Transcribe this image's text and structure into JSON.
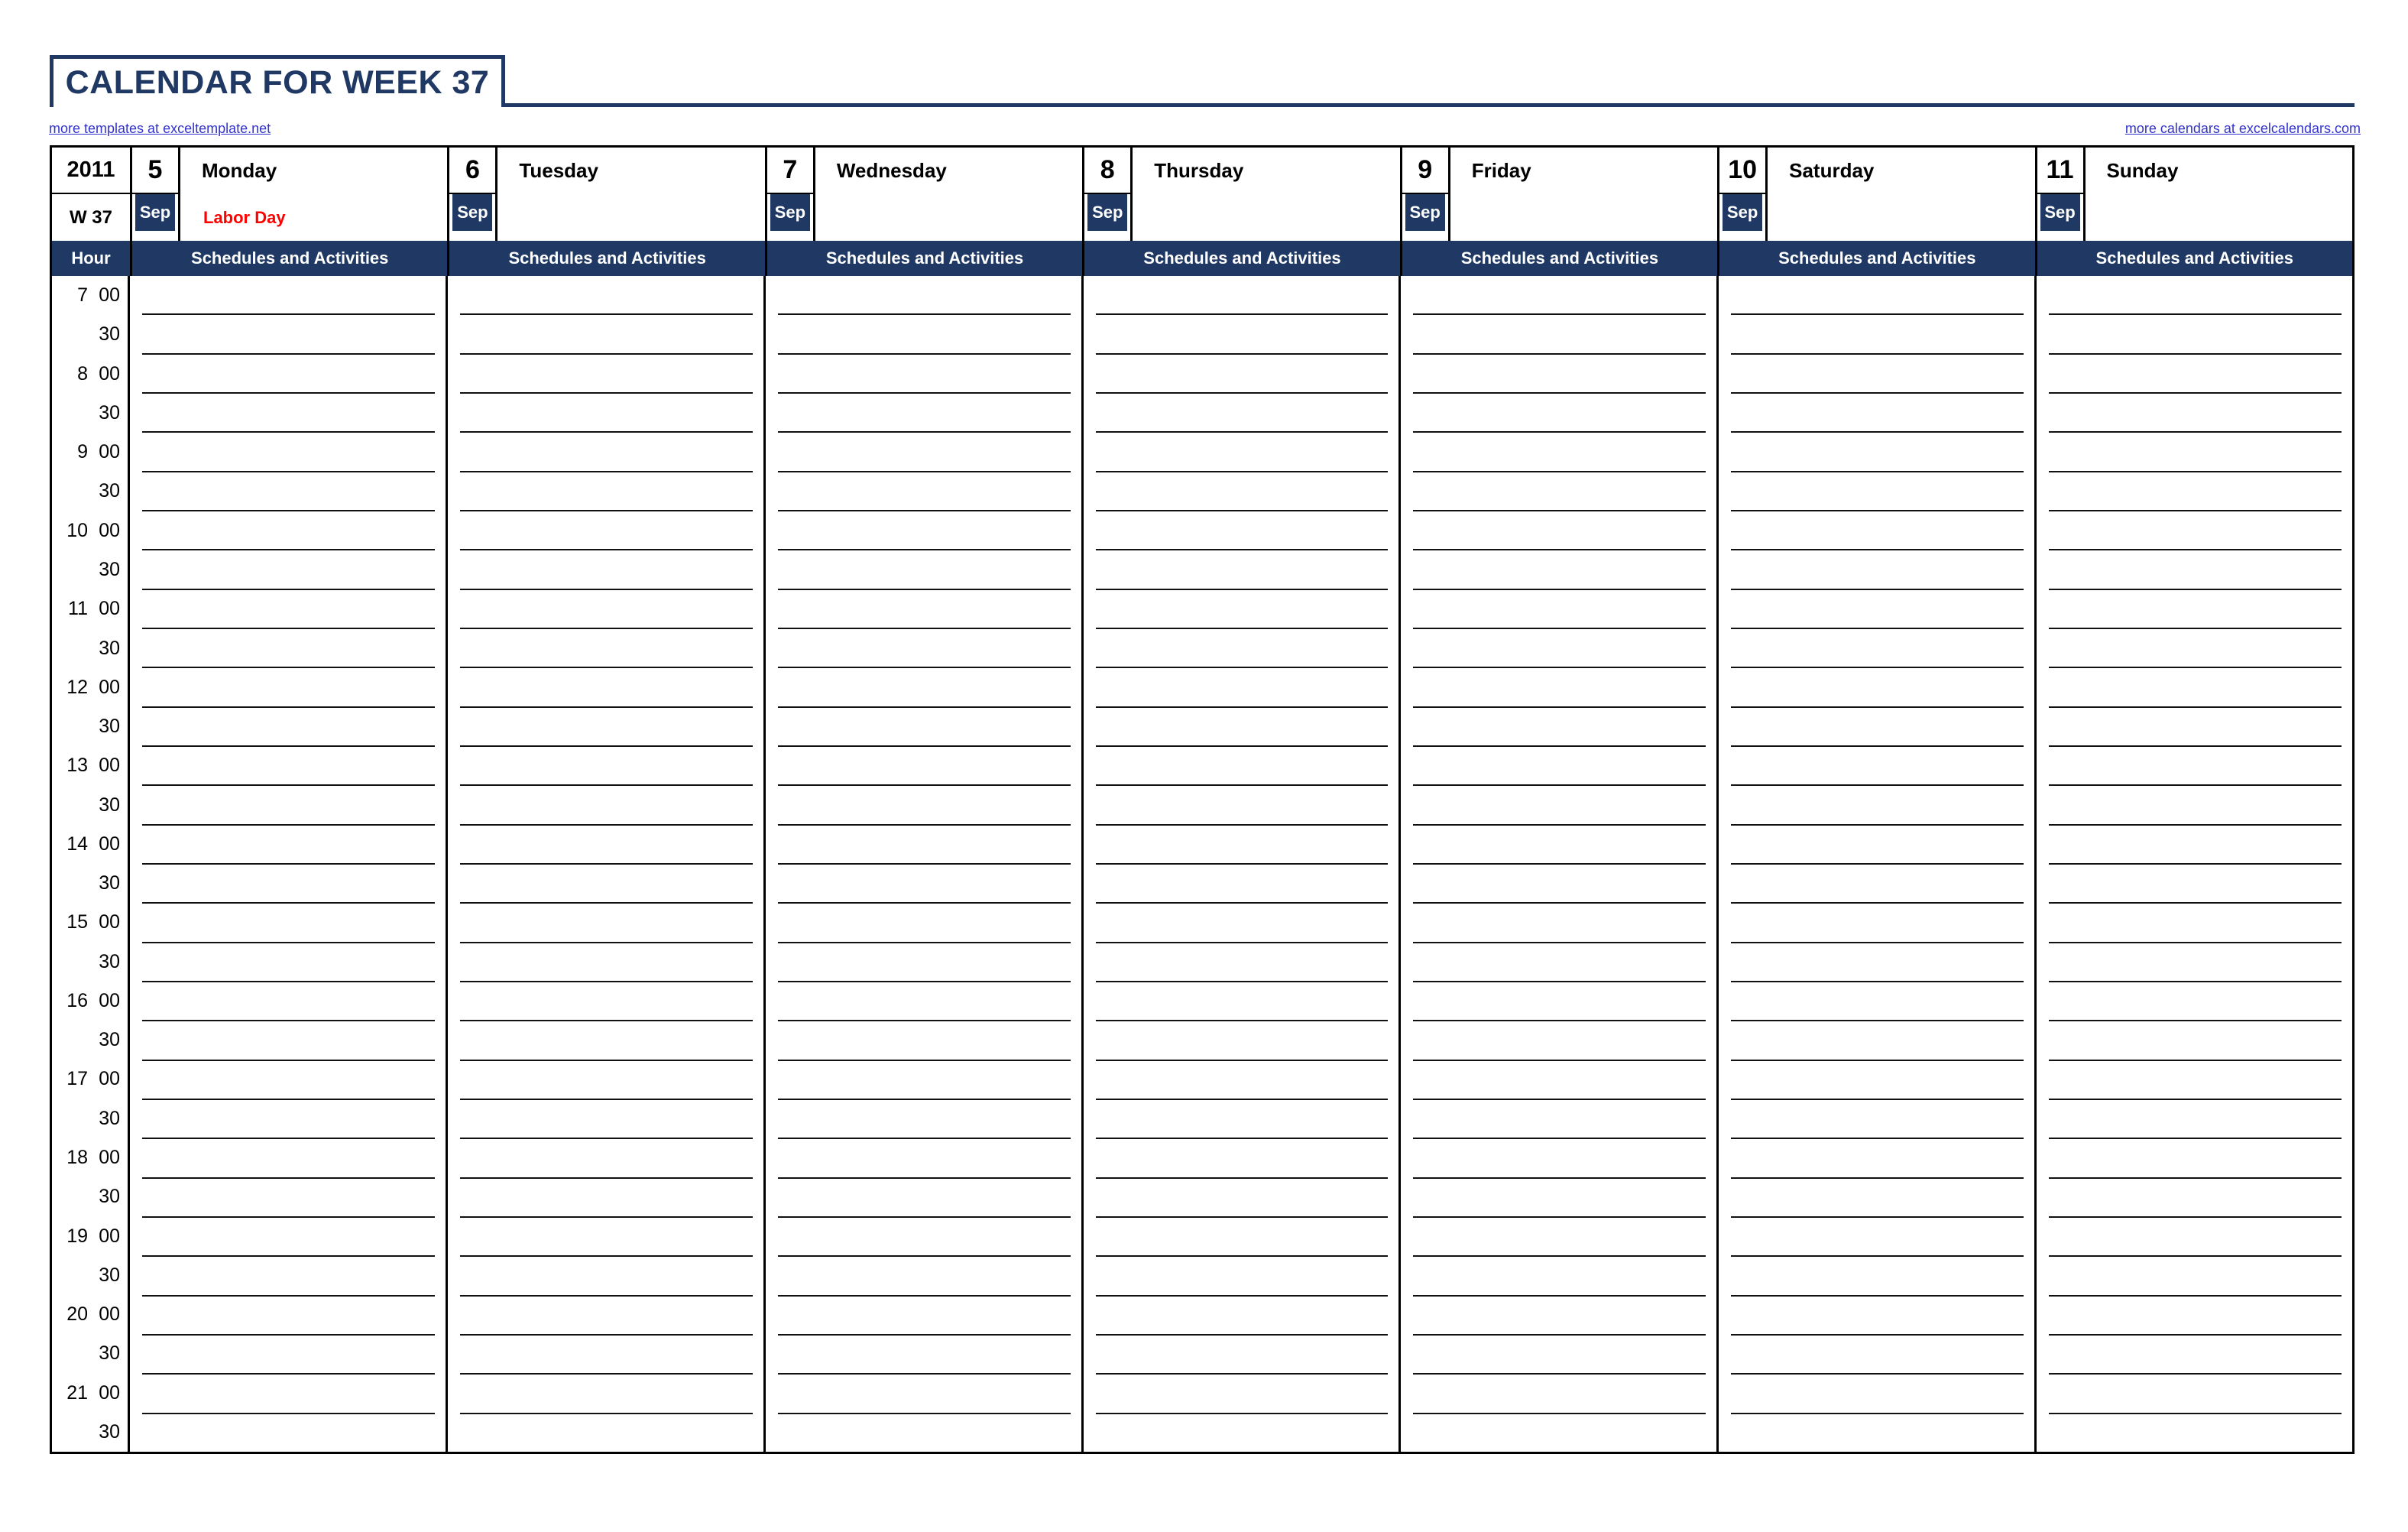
{
  "title": "CALENDAR FOR WEEK 37",
  "links": {
    "left": "more templates at exceltemplate.net",
    "right": "more calendars at excelcalendars.com"
  },
  "colors": {
    "navy": "#1F3864",
    "holiday_red": "#FF0000",
    "link_blue": "#3333CC",
    "grid_black": "#000000"
  },
  "corner": {
    "year": "2011",
    "week": "W 37",
    "hour_header": "Hour"
  },
  "schedule_header": "Schedules and Activities",
  "days": [
    {
      "date": "5",
      "month": "Sep",
      "name": "Monday",
      "holiday": "Labor Day"
    },
    {
      "date": "6",
      "month": "Sep",
      "name": "Tuesday",
      "holiday": ""
    },
    {
      "date": "7",
      "month": "Sep",
      "name": "Wednesday",
      "holiday": ""
    },
    {
      "date": "8",
      "month": "Sep",
      "name": "Thursday",
      "holiday": ""
    },
    {
      "date": "9",
      "month": "Sep",
      "name": "Friday",
      "holiday": ""
    },
    {
      "date": "10",
      "month": "Sep",
      "name": "Saturday",
      "holiday": ""
    },
    {
      "date": "11",
      "month": "Sep",
      "name": "Sunday",
      "holiday": ""
    }
  ],
  "time_slots": [
    {
      "hour": "7",
      "minute": "00"
    },
    {
      "hour": "",
      "minute": "30"
    },
    {
      "hour": "8",
      "minute": "00"
    },
    {
      "hour": "",
      "minute": "30"
    },
    {
      "hour": "9",
      "minute": "00"
    },
    {
      "hour": "",
      "minute": "30"
    },
    {
      "hour": "10",
      "minute": "00"
    },
    {
      "hour": "",
      "minute": "30"
    },
    {
      "hour": "11",
      "minute": "00"
    },
    {
      "hour": "",
      "minute": "30"
    },
    {
      "hour": "12",
      "minute": "00"
    },
    {
      "hour": "",
      "minute": "30"
    },
    {
      "hour": "13",
      "minute": "00"
    },
    {
      "hour": "",
      "minute": "30"
    },
    {
      "hour": "14",
      "minute": "00"
    },
    {
      "hour": "",
      "minute": "30"
    },
    {
      "hour": "15",
      "minute": "00"
    },
    {
      "hour": "",
      "minute": "30"
    },
    {
      "hour": "16",
      "minute": "00"
    },
    {
      "hour": "",
      "minute": "30"
    },
    {
      "hour": "17",
      "minute": "00"
    },
    {
      "hour": "",
      "minute": "30"
    },
    {
      "hour": "18",
      "minute": "00"
    },
    {
      "hour": "",
      "minute": "30"
    },
    {
      "hour": "19",
      "minute": "00"
    },
    {
      "hour": "",
      "minute": "30"
    },
    {
      "hour": "20",
      "minute": "00"
    },
    {
      "hour": "",
      "minute": "30"
    },
    {
      "hour": "21",
      "minute": "00"
    },
    {
      "hour": "",
      "minute": "30"
    }
  ]
}
